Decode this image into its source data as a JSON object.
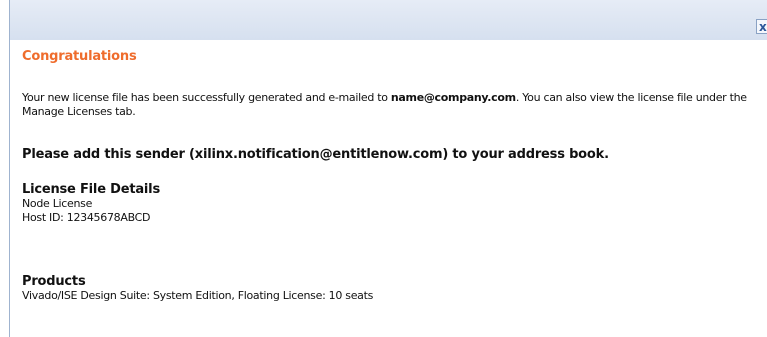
{
  "dialog": {
    "close_label": "x",
    "heading": "Congratulations",
    "message_before_email": "Your new license file has been successfully generated and e-mailed to",
    "email": "name@company.com",
    "message_after_email": ". You can also view the license file under the Manage Licenses tab.",
    "sender_notice": "Please add this sender (xilinx.notification@entitlenow.com) to your address book.",
    "license_details": {
      "title": "License File Details",
      "license_type": "Node License",
      "host_id": "Host ID: 12345678ABCD"
    },
    "products": {
      "title": "Products",
      "items": [
        "Vivado/ISE Design Suite: System Edition, Floating License: 10 seats"
      ]
    }
  },
  "colors": {
    "heading": "#ef6c2c",
    "titlebar": "#dce4f1",
    "close_icon": "#2b579a"
  }
}
